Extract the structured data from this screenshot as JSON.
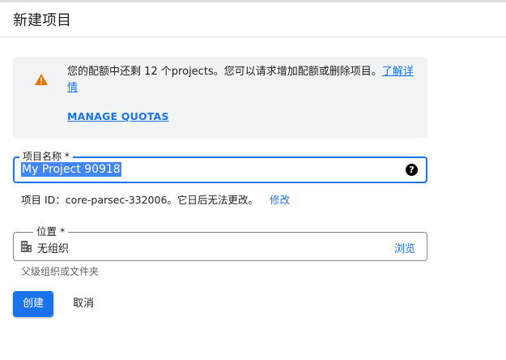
{
  "header": {
    "title": "新建项目"
  },
  "quota_alert": {
    "icon": "warning-icon",
    "icon_color": "#e37400",
    "message": "您的配额中还剩 12 个projects。您可以请求增加配额或删除项目。",
    "learn_more": "了解详情",
    "manage_quotas": "MANAGE QUOTAS"
  },
  "project_name": {
    "label": "项目名称 *",
    "value": "My Project 90918",
    "help_icon": "help-icon"
  },
  "project_id": {
    "prefix": "项目 ID：",
    "value": "core-parsec-332006",
    "suffix": "。它日后无法更改。",
    "edit_label": "修改"
  },
  "location": {
    "label": "位置 *",
    "icon": "organization-icon",
    "value": "无组织",
    "browse_label": "浏览",
    "hint": "父级组织或文件夹"
  },
  "actions": {
    "create_label": "创建",
    "cancel_label": "取消"
  },
  "colors": {
    "accent": "#1a73e8",
    "warning": "#e37400",
    "alert_bg": "#f1f3f4"
  }
}
